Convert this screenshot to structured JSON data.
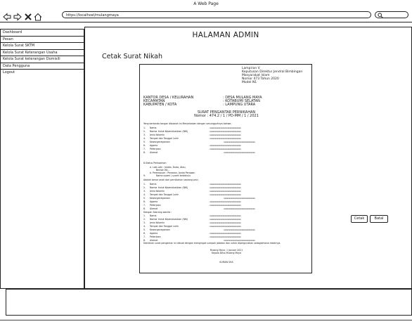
{
  "browser": {
    "window_title": "A Web Page",
    "url": "https://localhost/mulangmaya"
  },
  "sidebar": {
    "items": [
      {
        "label": "Dashboard"
      },
      {
        "label": "Pesan"
      },
      {
        "label": "Kelola Surat SKTM"
      },
      {
        "label": "Kelola Surat Keterangan Usaha"
      },
      {
        "label": "Kelola Surat keterangan Domisili"
      },
      {
        "label": "Data Pengguna"
      },
      {
        "label": "Logout"
      }
    ]
  },
  "main": {
    "page_title": "HALAMAN ADMIN",
    "section_title": "Cetak Surat Nikah",
    "print_button": "Cetak",
    "cancel_button": "Batal"
  },
  "document": {
    "header_lines": [
      "Lampiran V",
      "Keputusan Direktur Jendral Bimbingan",
      "Masyarakat Islam",
      "Nomor 473 Tahun 2020",
      "Model N1"
    ],
    "office_labels": [
      "KANTOR DESA / KELURAHAN",
      "KECAMATAN",
      "KABUPATEN / KOTA"
    ],
    "office_values": [
      ": DESA MULANG MAYA",
      ": KOTABUMI SELATAN",
      ": LAMPUNG UTARA"
    ],
    "letter_title": "SURAT PENGANTAR PERNIKAHAN",
    "letter_number": "Nomor : 474.2 / 1 / PD-MM / 1 / 2021",
    "intro": "Yang bertanda tangan dibawah ini Menjelaskan dengan sesungguhnya bahwa :",
    "person_fields": [
      "Nama",
      "Nomor Induk Kependudukan (NIK)",
      "Jenis Kelamin",
      "Tempat dan Tanggal Lahir",
      "Kewarganegaraan",
      "Agama",
      "Pekerjaan",
      "Alamat"
    ],
    "marital_heading": "8.Status Perkawinan",
    "marital_line_a": "a.   Laki-Laki : Jejaka, Duda, Atau,",
    "marital_line_a2": "Beristri Ke...",
    "marital_line_b": "b.   Perempuan : Perawan, Janda        Perawan",
    "marital_line_c": "Nama suami / suami terdahulu",
    "father_heading": "Adalah benar anak dari pernikahan seorang pria :",
    "mother_heading": "Dengan Seorang wanita :",
    "closing": "Demikian surat pengantar ini dibuat dengan mengingat sumpah jabatan dan untuk dipergunakan sebagaimana mestinya.",
    "sign_place": "Mulang Maya, 1 Januari 2021",
    "sign_role": "Kepala Desa Mulang Maya",
    "sign_name": "KUMAN SHA"
  }
}
